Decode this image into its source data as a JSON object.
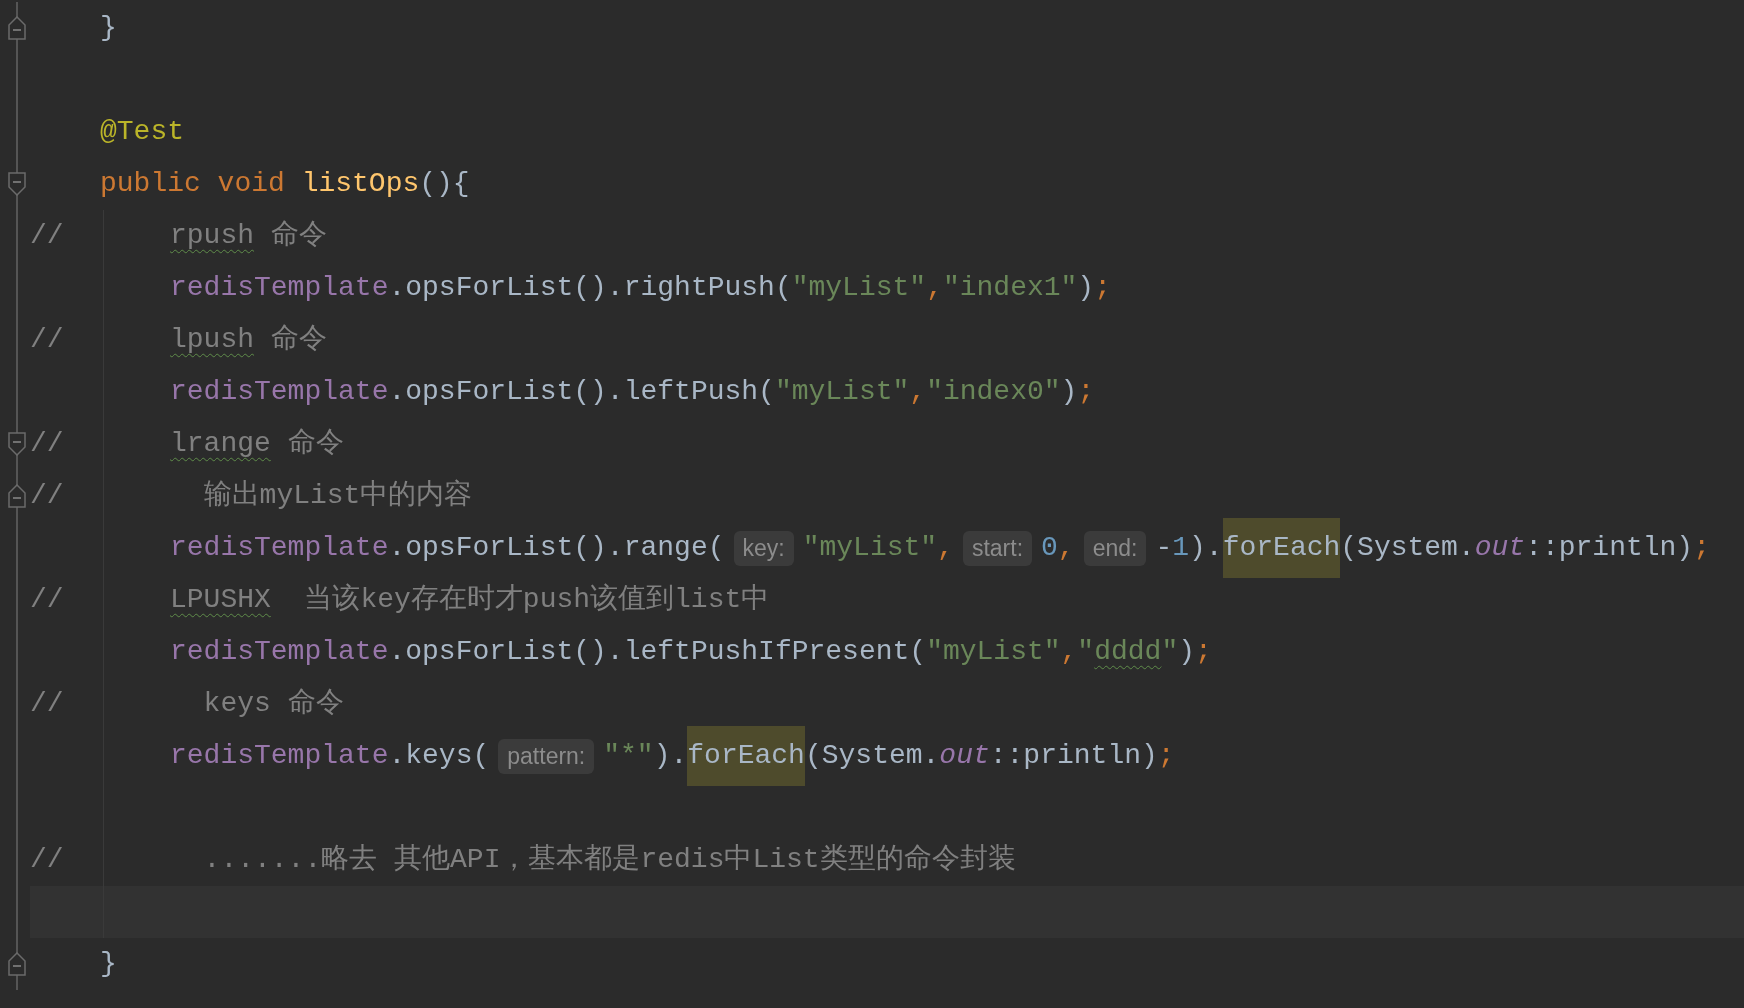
{
  "lines": [
    {
      "kind": "member",
      "fold": {
        "kind": "end"
      },
      "tokens": [
        {
          "kind": "plain",
          "t": "}"
        }
      ]
    },
    {
      "kind": "member"
    },
    {
      "kind": "member",
      "tokens": [
        {
          "kind": "annotation",
          "t": "@Test"
        }
      ]
    },
    {
      "kind": "member",
      "fold": {
        "kind": "start"
      },
      "tokens": [
        {
          "kind": "keyword",
          "t": "public void"
        },
        {
          "kind": "decl",
          "t": " listOps"
        },
        {
          "kind": "plain",
          "t": "(){"
        }
      ]
    },
    {
      "kind": "body",
      "lead": "//",
      "tokens": [
        {
          "kind": "comment",
          "t": "rpush",
          "typo": true
        },
        {
          "kind": "comment",
          "t": " 命令"
        }
      ]
    },
    {
      "kind": "body",
      "tokens": [
        {
          "kind": "field",
          "t": "redisTemplate"
        },
        {
          "kind": "plain",
          "t": ".opsForList().rightPush("
        },
        {
          "kind": "string",
          "t": "\"myList\""
        },
        {
          "kind": "orange",
          "t": ","
        },
        {
          "kind": "string",
          "t": "\"index1\""
        },
        {
          "kind": "plain",
          "t": ")"
        },
        {
          "kind": "orange",
          "t": ";"
        }
      ]
    },
    {
      "kind": "body",
      "lead": "//",
      "tokens": [
        {
          "kind": "comment",
          "t": "lpush",
          "typo": true
        },
        {
          "kind": "comment",
          "t": " 命令"
        }
      ]
    },
    {
      "kind": "body",
      "tokens": [
        {
          "kind": "field",
          "t": "redisTemplate"
        },
        {
          "kind": "plain",
          "t": ".opsForList().leftPush("
        },
        {
          "kind": "string",
          "t": "\"myList\""
        },
        {
          "kind": "orange",
          "t": ","
        },
        {
          "kind": "string",
          "t": "\"index0\""
        },
        {
          "kind": "plain",
          "t": ")"
        },
        {
          "kind": "orange",
          "t": ";"
        }
      ]
    },
    {
      "kind": "body",
      "lead": "//",
      "fold": {
        "kind": "start"
      },
      "tokens": [
        {
          "kind": "comment",
          "t": "lrange",
          "typo": true
        },
        {
          "kind": "comment",
          "t": " 命令"
        }
      ]
    },
    {
      "kind": "body",
      "lead": "//",
      "fold": {
        "kind": "end"
      },
      "tokens": [
        {
          "kind": "comment",
          "t": "  输出myList中的内容"
        }
      ]
    },
    {
      "kind": "body",
      "tokens": [
        {
          "kind": "field",
          "t": "redisTemplate"
        },
        {
          "kind": "plain",
          "t": ".opsForList().range("
        },
        {
          "kind": "hint",
          "t": "key:"
        },
        {
          "kind": "string",
          "t": "\"myList\""
        },
        {
          "kind": "orange",
          "t": ","
        },
        {
          "kind": "hint",
          "t": "start:"
        },
        {
          "kind": "number",
          "t": "0"
        },
        {
          "kind": "orange",
          "t": ","
        },
        {
          "kind": "hint",
          "t": "end:"
        },
        {
          "kind": "plain",
          "t": "-"
        },
        {
          "kind": "number",
          "t": "1"
        },
        {
          "kind": "plain",
          "t": ")."
        },
        {
          "kind": "plain",
          "t": "forEach",
          "highlight": true
        },
        {
          "kind": "plain",
          "t": "(System."
        },
        {
          "kind": "static",
          "t": "out"
        },
        {
          "kind": "plain",
          "t": "::println)"
        },
        {
          "kind": "orange",
          "t": ";"
        }
      ]
    },
    {
      "kind": "body",
      "lead": "//",
      "tokens": [
        {
          "kind": "comment",
          "t": "LPUSHX",
          "typo": true
        },
        {
          "kind": "comment",
          "t": "  当该key存在时才push该值到list中"
        }
      ]
    },
    {
      "kind": "body",
      "tokens": [
        {
          "kind": "field",
          "t": "redisTemplate"
        },
        {
          "kind": "plain",
          "t": ".opsForList().leftPushIfPresent("
        },
        {
          "kind": "string",
          "t": "\"myList\""
        },
        {
          "kind": "orange",
          "t": ","
        },
        {
          "kind": "string",
          "t": "\""
        },
        {
          "kind": "string",
          "t": "dddd",
          "typo": true
        },
        {
          "kind": "string",
          "t": "\""
        },
        {
          "kind": "plain",
          "t": ")"
        },
        {
          "kind": "orange",
          "t": ";"
        }
      ]
    },
    {
      "kind": "body",
      "lead": "//",
      "tokens": [
        {
          "kind": "comment",
          "t": "  keys 命令"
        }
      ]
    },
    {
      "kind": "body",
      "tokens": [
        {
          "kind": "field",
          "t": "redisTemplate"
        },
        {
          "kind": "plain",
          "t": ".keys("
        },
        {
          "kind": "hint",
          "t": "pattern:"
        },
        {
          "kind": "string",
          "t": "\"*\""
        },
        {
          "kind": "plain",
          "t": ")."
        },
        {
          "kind": "plain",
          "t": "forEach",
          "highlight": true
        },
        {
          "kind": "plain",
          "t": "(System."
        },
        {
          "kind": "static",
          "t": "out"
        },
        {
          "kind": "plain",
          "t": "::println)"
        },
        {
          "kind": "orange",
          "t": ";"
        }
      ]
    },
    {
      "kind": "body"
    },
    {
      "kind": "body",
      "lead": "//",
      "tokens": [
        {
          "kind": "comment",
          "t": "  .......略去 其他API，基本都是redis中List类型的命令封装"
        }
      ]
    },
    {
      "kind": "current"
    },
    {
      "kind": "member",
      "fold": {
        "kind": "end"
      },
      "tokens": [
        {
          "kind": "plain",
          "t": "}"
        }
      ]
    }
  ]
}
